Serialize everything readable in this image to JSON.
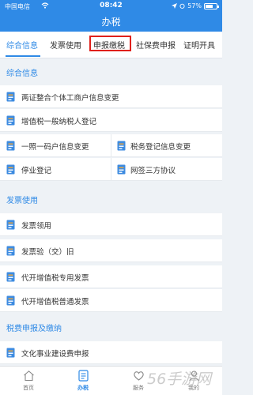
{
  "status_bar": {
    "carrier": "中国电信",
    "time": "08:42",
    "battery_text": "57%",
    "battery_level": 0.57
  },
  "nav": {
    "title": "办税"
  },
  "tabs": [
    {
      "label": "综合信息",
      "active": true
    },
    {
      "label": "发票使用",
      "active": false
    },
    {
      "label": "申报缴税",
      "active": false,
      "highlighted": true
    },
    {
      "label": "社保费申报",
      "active": false
    },
    {
      "label": "证明开具",
      "active": false
    }
  ],
  "sections": [
    {
      "title": "综合信息",
      "items": [
        "两证整合个体工商户信息变更",
        "增值税一般纳税人登记",
        "一照一码户信息变更",
        "税务登记信息变更",
        "停业登记",
        "网签三方协议"
      ]
    },
    {
      "title": "发票使用",
      "items": [
        "发票领用",
        "发票验（交）旧",
        "代开增值税专用发票",
        "代开增值税普通发票"
      ]
    },
    {
      "title": "税费申报及缴纳",
      "items": [
        "文化事业建设费申报"
      ]
    }
  ],
  "bottom_nav": [
    {
      "label": "首页",
      "icon": "home-icon",
      "active": false
    },
    {
      "label": "办税",
      "icon": "document-list-icon",
      "active": true
    },
    {
      "label": "服务",
      "icon": "heart-icon",
      "active": false
    },
    {
      "label": "我的",
      "icon": "user-icon",
      "active": false
    }
  ],
  "watermark": "56手游网",
  "colors": {
    "primary": "#2f8ae6",
    "highlight_box": "#e0201b",
    "icon_blue": "#3d8be0",
    "icon_orange": "#f2a93b"
  }
}
